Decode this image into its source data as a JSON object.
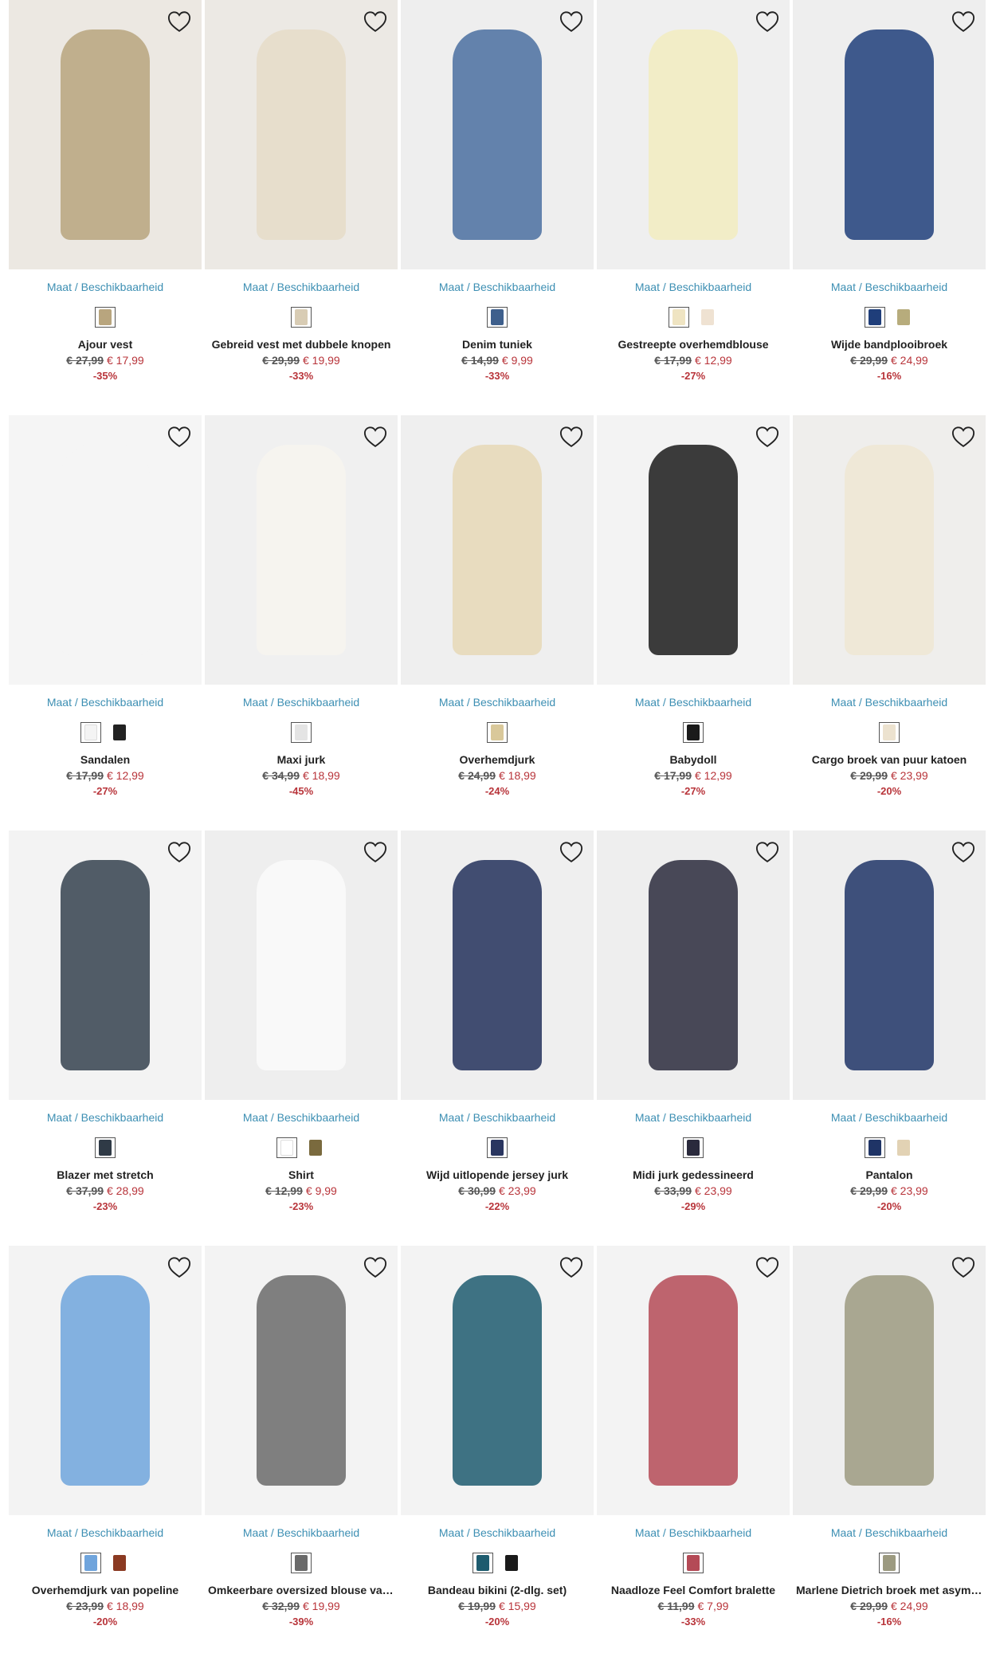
{
  "size_link_label": "Maat / Beschikbaarheid",
  "products": [
    {
      "name": "Ajour vest",
      "old_price": "€ 27,99",
      "new_price": "€ 17,99",
      "discount": "-35%",
      "photo_bg": "#ece8e2",
      "item_color": "#b8a57e",
      "swatches": [
        "#b8a57e"
      ]
    },
    {
      "name": "Gebreid vest met dubbele knopen",
      "old_price": "€ 29,99",
      "new_price": "€ 19,99",
      "discount": "-33%",
      "photo_bg": "#ece9e4",
      "item_color": "#e6dcc8",
      "swatches": [
        "#d8ccb4"
      ]
    },
    {
      "name": "Denim tuniek",
      "old_price": "€ 14,99",
      "new_price": "€ 9,99",
      "discount": "-33%",
      "photo_bg": "#eeeeee",
      "item_color": "#4a6fa0",
      "swatches": [
        "#3e5f8c"
      ]
    },
    {
      "name": "Gestreepte overhemdblouse",
      "old_price": "€ 17,99",
      "new_price": "€ 12,99",
      "discount": "-27%",
      "photo_bg": "#efefef",
      "item_color": "#f2ecc0",
      "swatches": [
        "#efe4c2",
        "#efe2d2"
      ]
    },
    {
      "name": "Wijde bandplooibroek",
      "old_price": "€ 29,99",
      "new_price": "€ 24,99",
      "discount": "-16%",
      "photo_bg": "#eeeeee",
      "item_color": "#1f3e7a",
      "swatches": [
        "#1f3e7a",
        "#b7ac7c"
      ]
    },
    {
      "name": "Sandalen",
      "old_price": "€ 17,99",
      "new_price": "€ 12,99",
      "discount": "-27%",
      "photo_bg": "#f5f5f5",
      "item_color": "#f5f5f5",
      "swatches": [
        "#f4f4f4",
        "#222222"
      ]
    },
    {
      "name": "Maxi jurk",
      "old_price": "€ 34,99",
      "new_price": "€ 18,99",
      "discount": "-45%",
      "photo_bg": "#f0f0f0",
      "item_color": "#f7f5ef",
      "swatches": [
        "#e4e4e4"
      ]
    },
    {
      "name": "Overhemdjurk",
      "old_price": "€ 24,99",
      "new_price": "€ 18,99",
      "discount": "-24%",
      "photo_bg": "#efefef",
      "item_color": "#e6d8b6",
      "swatches": [
        "#d9c89a"
      ]
    },
    {
      "name": "Babydoll",
      "old_price": "€ 17,99",
      "new_price": "€ 12,99",
      "discount": "-27%",
      "photo_bg": "#f3f3f3",
      "item_color": "#1a1a1a",
      "swatches": [
        "#1a1a1a"
      ]
    },
    {
      "name": "Cargo broek van puur katoen",
      "old_price": "€ 29,99",
      "new_price": "€ 23,99",
      "discount": "-20%",
      "photo_bg": "#efeeec",
      "item_color": "#efe6d4",
      "swatches": [
        "#ece2cf"
      ]
    },
    {
      "name": "Blazer met stretch",
      "old_price": "€ 37,99",
      "new_price": "€ 28,99",
      "discount": "-23%",
      "photo_bg": "#f3f3f3",
      "item_color": "#34414e",
      "swatches": [
        "#2f3a46"
      ]
    },
    {
      "name": "Shirt",
      "old_price": "€ 12,99",
      "new_price": "€ 9,99",
      "discount": "-23%",
      "photo_bg": "#eeeeee",
      "item_color": "#fafafa",
      "swatches": [
        "#ffffff",
        "#7a6a3e"
      ]
    },
    {
      "name": "Wijd uitlopende jersey jurk",
      "old_price": "€ 30,99",
      "new_price": "€ 23,99",
      "discount": "-22%",
      "photo_bg": "#efefef",
      "item_color": "#22305a",
      "swatches": [
        "#2a3660"
      ]
    },
    {
      "name": "Midi jurk gedessineerd",
      "old_price": "€ 33,99",
      "new_price": "€ 23,99",
      "discount": "-29%",
      "photo_bg": "#eeeeee",
      "item_color": "#2a2a3c",
      "swatches": [
        "#2a2a3c"
      ]
    },
    {
      "name": "Pantalon",
      "old_price": "€ 29,99",
      "new_price": "€ 23,99",
      "discount": "-20%",
      "photo_bg": "#eeeeee",
      "item_color": "#1f3466",
      "swatches": [
        "#1f3466",
        "#e2d2b4"
      ]
    },
    {
      "name": "Overhemdjurk van popeline",
      "old_price": "€ 23,99",
      "new_price": "€ 18,99",
      "discount": "-20%",
      "photo_bg": "#f3f3f3",
      "item_color": "#6fa4dc",
      "swatches": [
        "#6fa4dc",
        "#8b3a22"
      ]
    },
    {
      "name": "Omkeerbare oversized blouse van viscose",
      "old_price": "€ 32,99",
      "new_price": "€ 19,99",
      "discount": "-39%",
      "photo_bg": "#f3f3f3",
      "item_color": "#6a6a6a",
      "swatches": [
        "#6a6a6a"
      ]
    },
    {
      "name": "Bandeau bikini (2-dlg. set)",
      "old_price": "€ 19,99",
      "new_price": "€ 15,99",
      "discount": "-20%",
      "photo_bg": "#f3f3f3",
      "item_color": "#1d5b6e",
      "swatches": [
        "#1d5b6e",
        "#1a1a1a"
      ]
    },
    {
      "name": "Naadloze Feel Comfort bralette",
      "old_price": "€ 11,99",
      "new_price": "€ 7,99",
      "discount": "-33%",
      "photo_bg": "#f3f3f3",
      "item_color": "#b44a56",
      "swatches": [
        "#b44a56"
      ]
    },
    {
      "name": "Marlene Dietrich broek met asymmetrische sluiting",
      "old_price": "€ 29,99",
      "new_price": "€ 24,99",
      "discount": "-16%",
      "photo_bg": "#eeeeee",
      "item_color": "#9c9a80",
      "swatches": [
        "#9c9a80"
      ]
    }
  ]
}
